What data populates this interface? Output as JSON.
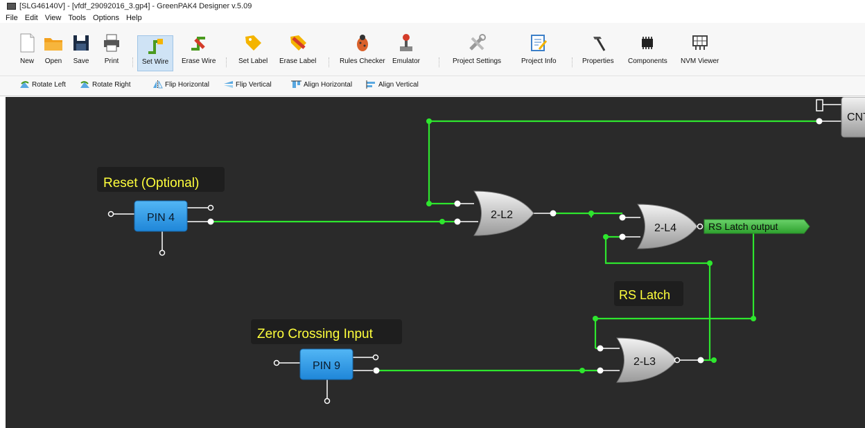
{
  "window": {
    "title": "[SLG46140V] - [vfdf_29092016_3.gp4] - GreenPAK4 Designer v.5.09"
  },
  "menu": [
    "File",
    "Edit",
    "View",
    "Tools",
    "Options",
    "Help"
  ],
  "toolbar": {
    "new": "New",
    "open": "Open",
    "save": "Save",
    "print": "Print",
    "set_wire": "Set Wire",
    "erase_wire": "Erase Wire",
    "set_label": "Set Label",
    "erase_label": "Erase Label",
    "rules_checker": "Rules Checker",
    "emulator": "Emulator",
    "project_settings": "Project Settings",
    "project_info": "Project Info",
    "properties": "Properties",
    "components": "Components",
    "nvm_viewer": "NVM Viewer"
  },
  "toolbar2": {
    "rotate_left": "Rotate Left",
    "rotate_right": "Rotate Right",
    "flip_horizontal": "Flip Horizontal",
    "flip_vertical": "Flip Vertical",
    "align_horizontal": "Align Horizontal",
    "align_vertical": "Align Vertical"
  },
  "canvas": {
    "labels": {
      "reset": "Reset (Optional)",
      "zero_crossing": "Zero Crossing Input",
      "rs_latch": "RS Latch"
    },
    "pins": {
      "pin4": "PIN 4",
      "pin9": "PIN 9"
    },
    "gates": {
      "l2": "2-L2",
      "l4": "2-L4",
      "l3": "2-L3"
    },
    "output_label": "RS Latch output",
    "cnt_label": "CNT"
  },
  "colors": {
    "wire": "#2ee62e",
    "canvas": "#2a2a2a",
    "pin": "#2e9ee8",
    "label_text": "#ffff3c"
  }
}
